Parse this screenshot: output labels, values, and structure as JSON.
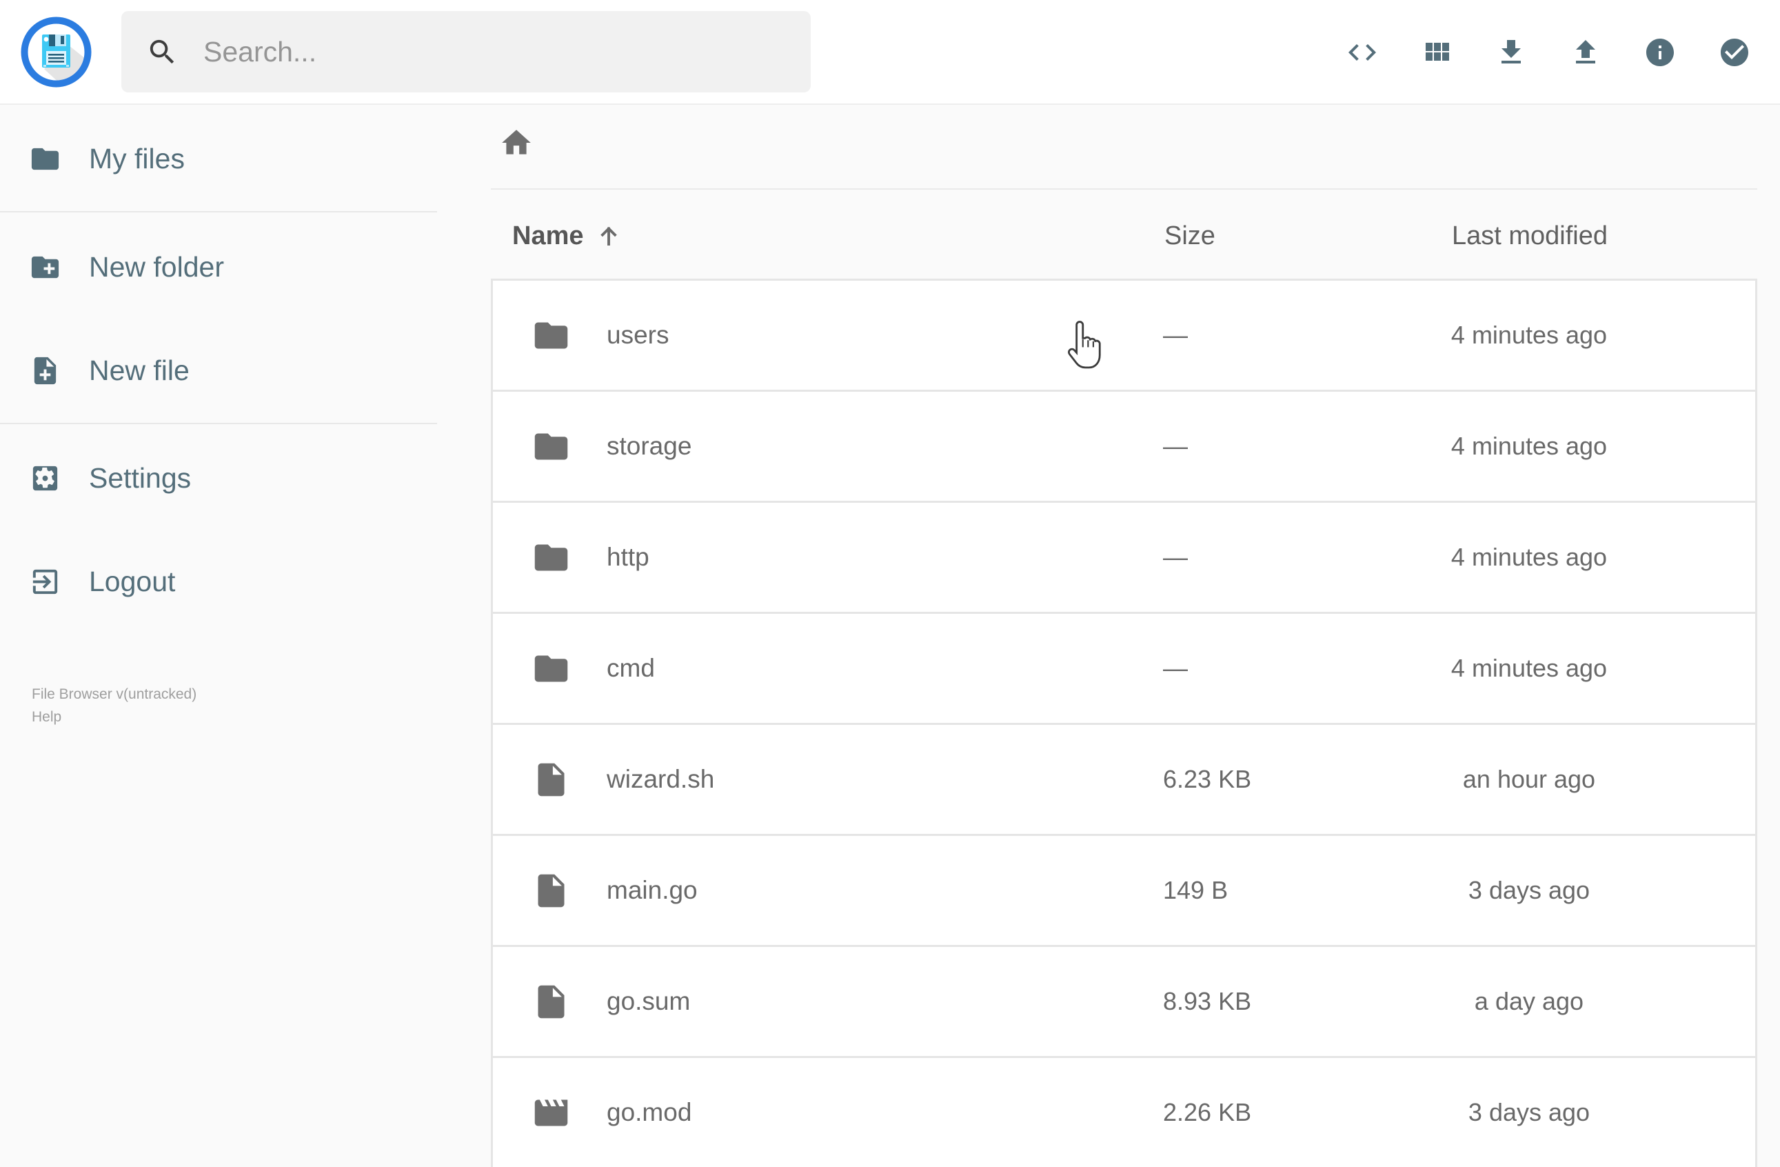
{
  "topbar": {
    "search_placeholder": "Search...",
    "actions": [
      {
        "icon": "code-icon"
      },
      {
        "icon": "grid-view-icon"
      },
      {
        "icon": "download-icon"
      },
      {
        "icon": "upload-icon"
      },
      {
        "icon": "info-icon"
      },
      {
        "icon": "select-check-icon"
      }
    ]
  },
  "sidebar": {
    "items": [
      {
        "label": "My files",
        "icon": "folder-icon"
      },
      {
        "label": "New folder",
        "icon": "new-folder-icon"
      },
      {
        "label": "New file",
        "icon": "new-file-icon"
      },
      {
        "label": "Settings",
        "icon": "settings-icon"
      },
      {
        "label": "Logout",
        "icon": "logout-icon"
      }
    ],
    "version": "File Browser v(untracked)",
    "help": "Help"
  },
  "listing": {
    "columns": {
      "name": "Name",
      "size": "Size",
      "modified": "Last modified"
    },
    "rows": [
      {
        "name": "users",
        "type": "folder",
        "size": "—",
        "modified": "4 minutes ago"
      },
      {
        "name": "storage",
        "type": "folder",
        "size": "—",
        "modified": "4 minutes ago"
      },
      {
        "name": "http",
        "type": "folder",
        "size": "—",
        "modified": "4 minutes ago"
      },
      {
        "name": "cmd",
        "type": "folder",
        "size": "—",
        "modified": "4 minutes ago"
      },
      {
        "name": "wizard.sh",
        "type": "file",
        "size": "6.23 KB",
        "modified": "an hour ago"
      },
      {
        "name": "main.go",
        "type": "file",
        "size": "149 B",
        "modified": "3 days ago"
      },
      {
        "name": "go.sum",
        "type": "file",
        "size": "8.93 KB",
        "modified": "a day ago"
      },
      {
        "name": "go.mod",
        "type": "movie",
        "size": "2.26 KB",
        "modified": "3 days ago"
      }
    ]
  },
  "colors": {
    "accent_blue": "#2b7ce0",
    "floppy_cyan": "#3ec9f4",
    "slate": "#546e7a",
    "row_text": "#696969",
    "background": "#fafafa"
  }
}
